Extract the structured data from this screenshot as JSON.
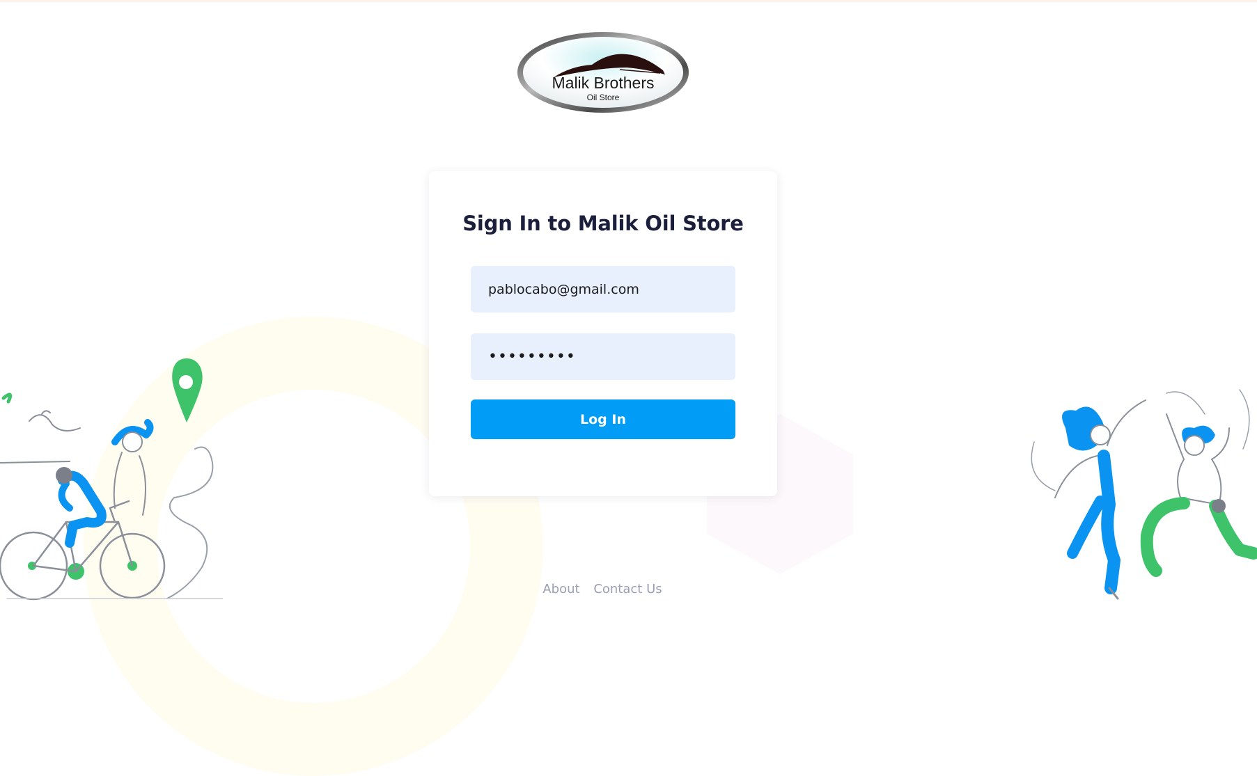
{
  "brand": {
    "logo_name": "Malik Brothers",
    "logo_tagline": "Oil Store"
  },
  "login": {
    "title": "Sign In to Malik Oil Store",
    "email_value": "pablocabo@gmail.com",
    "password_value": "pablocabo",
    "submit_label": "Log In"
  },
  "footer": {
    "links": [
      {
        "label": "About"
      },
      {
        "label": "Contact Us"
      }
    ]
  },
  "colors": {
    "primary": "#009cf6",
    "title": "#1b1f3b",
    "input_bg": "#e8effd",
    "footer_link": "#9a9fb5",
    "illustration_blue": "#0a93f0",
    "illustration_green": "#3ec36b"
  },
  "icons": [
    "logo-car-icon",
    "location-pin-icon"
  ]
}
